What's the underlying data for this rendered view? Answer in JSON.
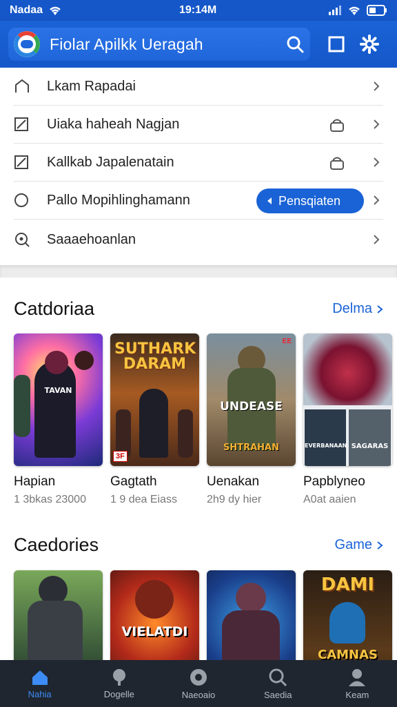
{
  "status": {
    "carrier": "Nadaa",
    "time": "19:14M"
  },
  "header": {
    "title": "Fiolar Apilkk Ueragah"
  },
  "menu": [
    {
      "label": "Lkam Rapadai",
      "icon": "home-outline-icon"
    },
    {
      "label": "Uiaka haheah Nagjan",
      "icon": "checkbox-icon",
      "locked": true
    },
    {
      "label": "Kallkab Japalenatain",
      "icon": "checkbox-icon",
      "locked": true
    },
    {
      "label": "Pallo Mopihlinghamann",
      "icon": "circle-icon",
      "button": "Pensqiaten"
    },
    {
      "label": "Saaaehoanlan",
      "icon": "search-circle-icon"
    }
  ],
  "section1": {
    "title": "Catdoriaa",
    "link": "Delma",
    "cards": [
      {
        "title": "Hapian",
        "sub": "1 3bkas 23000",
        "overlay": "TAVAN"
      },
      {
        "title": "Gagtath",
        "sub": "1 9 dea Eiass",
        "overlay": "SUTHARK DARAM",
        "badge": "3F"
      },
      {
        "title": "Uenakan",
        "sub": "2h9 dy hier",
        "overlay": "UNDEASE",
        "overlay2": "SHTRAHAN",
        "badge": "EE"
      },
      {
        "title": "Papblyneo",
        "sub": "A0at aaien",
        "overlay": "EVERBANAAN",
        "overlay2": "SAGARAS"
      }
    ]
  },
  "section2": {
    "title": "Caedories",
    "link": "Game",
    "cards": [
      {
        "overlay": ""
      },
      {
        "overlay": "VIELATDI"
      },
      {
        "overlay": ""
      },
      {
        "overlay": "DAMI",
        "overlay2": "CAMNAS"
      }
    ]
  },
  "nav": [
    {
      "label": "Nahia",
      "icon": "home-icon",
      "active": true
    },
    {
      "label": "Dogelle",
      "icon": "tree-icon"
    },
    {
      "label": "Naeoaio",
      "icon": "compass-icon"
    },
    {
      "label": "Saedia",
      "icon": "search-icon"
    },
    {
      "label": "Keam",
      "icon": "person-icon"
    }
  ],
  "colors": {
    "primary": "#1a63d6",
    "nav_bg": "#1f2630",
    "nav_active": "#3d8cf5"
  }
}
